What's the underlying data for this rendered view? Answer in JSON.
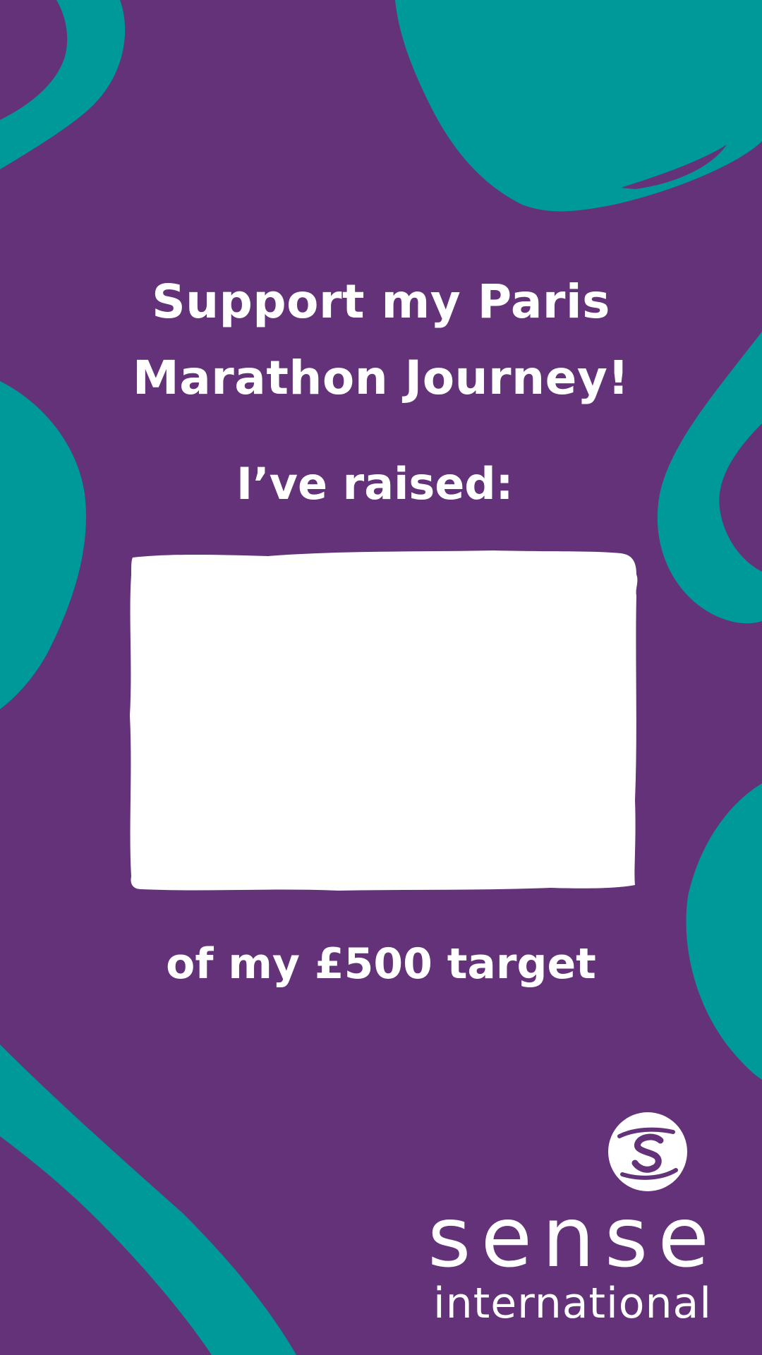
{
  "poster": {
    "title_line1": "Support my Paris",
    "title_line2": "Marathon Journey!",
    "raised_label": "I’ve raised:",
    "raised_amount": "",
    "target_text": "of my £500 target"
  },
  "logo": {
    "name": "sense",
    "subtitle": "international",
    "icon": "sense-hands-s-icon"
  },
  "colors": {
    "background": "#643278",
    "accent": "#00999A",
    "text": "#FFFFFF"
  }
}
